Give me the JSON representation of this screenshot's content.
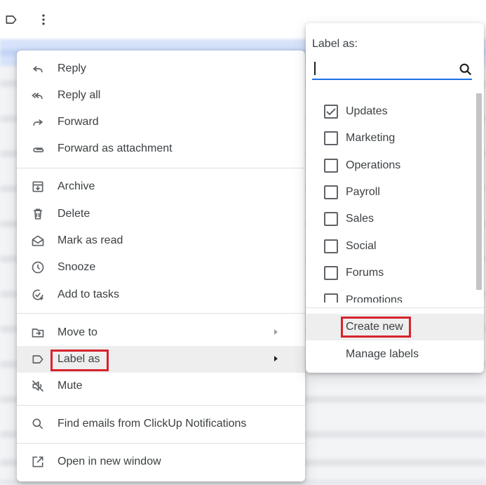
{
  "toolbar": {
    "label_icon": "label-icon",
    "more_icon": "more-vert-icon"
  },
  "main_menu": {
    "reply": "Reply",
    "reply_all": "Reply all",
    "forward": "Forward",
    "forward_attachment": "Forward as attachment",
    "archive": "Archive",
    "delete": "Delete",
    "mark_read": "Mark as read",
    "snooze": "Snooze",
    "add_tasks": "Add to tasks",
    "move_to": "Move to",
    "label_as": "Label as",
    "mute": "Mute",
    "find_emails": "Find emails from ClickUp Notifications",
    "open_window": "Open in new window"
  },
  "label_menu": {
    "title": "Label as:",
    "search_value": "",
    "labels": [
      {
        "name": "Updates",
        "checked": true
      },
      {
        "name": "Marketing",
        "checked": false
      },
      {
        "name": "Operations",
        "checked": false
      },
      {
        "name": "Payroll",
        "checked": false
      },
      {
        "name": "Sales",
        "checked": false
      },
      {
        "name": "Social",
        "checked": false
      },
      {
        "name": "Forums",
        "checked": false
      },
      {
        "name": "Promotions",
        "checked": false
      }
    ],
    "create_new": "Create new",
    "manage_labels": "Manage labels"
  },
  "colors": {
    "highlight_box": "#d6232c",
    "search_underline": "#1a73e8",
    "hover_bg": "#eeeeee"
  }
}
